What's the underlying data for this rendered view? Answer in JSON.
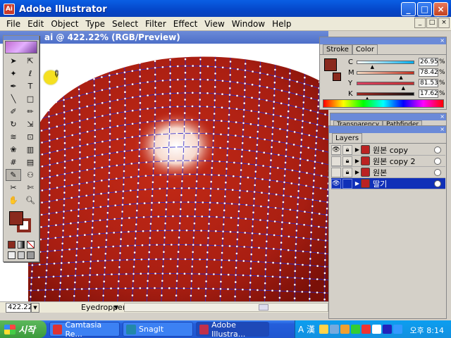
{
  "window": {
    "title": "Adobe Illustrator",
    "icon": "illustrator-icon"
  },
  "menu": [
    "File",
    "Edit",
    "Object",
    "Type",
    "Select",
    "Filter",
    "Effect",
    "View",
    "Window",
    "Help"
  ],
  "document": {
    "title": "ai @ 422.22% (RGB/Preview)",
    "zoom": "422.22%",
    "tool_status": "Eyedropper"
  },
  "color_panel": {
    "tabs": [
      "Stroke",
      "Color"
    ],
    "active_tab": "Color",
    "fill_color": "#8a2a1e",
    "channels": [
      {
        "label": "C",
        "value": "26.95",
        "percent": "%",
        "slider": 0.27,
        "gradient": [
          "#ffffff",
          "#00aeef"
        ]
      },
      {
        "label": "M",
        "value": "78.42",
        "percent": "%",
        "slider": 0.78,
        "gradient": [
          "#f0d8c0",
          "#c03020"
        ]
      },
      {
        "label": "Y",
        "value": "81.53",
        "percent": "%",
        "slider": 0.82,
        "gradient": [
          "#d84060",
          "#c03030"
        ]
      },
      {
        "label": "K",
        "value": "17.62",
        "percent": "%",
        "slider": 0.18,
        "gradient": [
          "#a02820",
          "#101010"
        ]
      }
    ]
  },
  "transparency_panel": {
    "tabs": [
      "Transparency",
      "Pathfinder"
    ]
  },
  "layers_panel": {
    "tab": "Layers",
    "layers": [
      {
        "name": "원본 copy",
        "visible": true,
        "locked": true,
        "selected": false
      },
      {
        "name": "원본 copy 2",
        "visible": false,
        "locked": true,
        "selected": false
      },
      {
        "name": "원본",
        "visible": false,
        "locked": true,
        "selected": false
      },
      {
        "name": "딸기",
        "visible": true,
        "locked": false,
        "selected": true
      }
    ]
  },
  "taskbar": {
    "start_label": "시작",
    "tasks": [
      {
        "label": "Camtasia Re...",
        "icon": "camtasia-icon",
        "color": "#d33",
        "active": false
      },
      {
        "label": "SnagIt",
        "icon": "snagit-icon",
        "color": "#28a",
        "active": false
      },
      {
        "label": "Adobe Illustra...",
        "icon": "illustrator-icon",
        "color": "#c0304a",
        "active": true
      }
    ],
    "tray_text": "A 漢",
    "clock": "오후 8:14"
  }
}
